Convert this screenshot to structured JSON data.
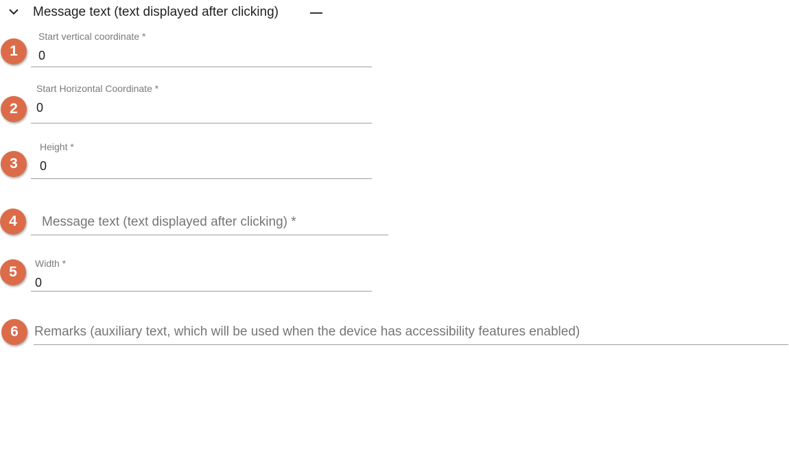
{
  "section": {
    "title": "Message text (text displayed after clicking)",
    "collapse_icon": "chevron-down-icon",
    "dash_icon": "minus-icon"
  },
  "badge_color": "#dc6c49",
  "fields": [
    {
      "number": "1",
      "label": "Start vertical coordinate *",
      "value": "0"
    },
    {
      "number": "2",
      "label": "Start Horizontal Coordinate *",
      "value": "0"
    },
    {
      "number": "3",
      "label": "Height *",
      "value": "0"
    },
    {
      "number": "4",
      "placeholder": "Message text (text displayed after clicking) *"
    },
    {
      "number": "5",
      "label": "Width *",
      "value": "0"
    },
    {
      "number": "6",
      "placeholder": "Remarks (auxiliary text, which will be used when the device has accessibility features enabled)"
    }
  ]
}
